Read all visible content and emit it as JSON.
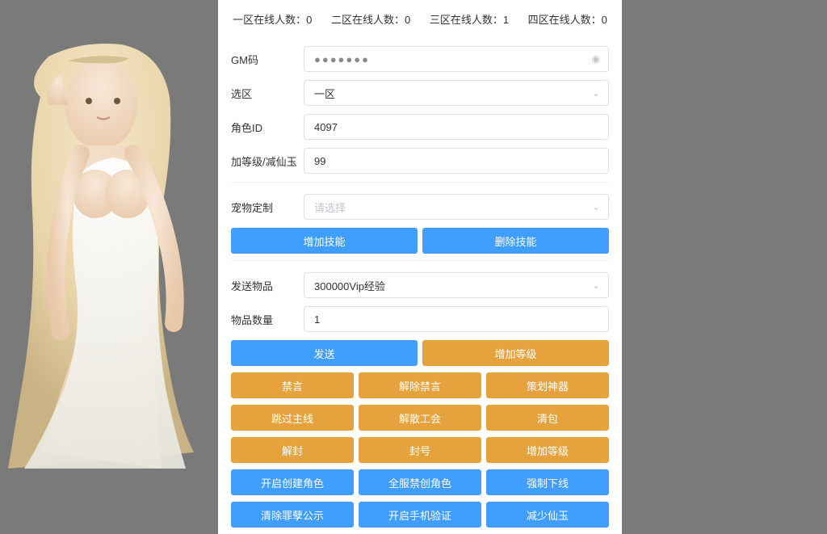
{
  "stats": {
    "zone1": "一区在线人数：0",
    "zone2": "二区在线人数：0",
    "zone3": "三区在线人数：1",
    "zone4": "四区在线人数：0"
  },
  "form": {
    "gm_code_label": "GM码",
    "gm_code_value": "●●●●●●●",
    "zone_label": "选区",
    "zone_value": "一区",
    "role_id_label": "角色ID",
    "role_id_value": "4097",
    "level_label": "加等级/减仙玉",
    "level_value": "99",
    "pet_label": "宠物定制",
    "pet_placeholder": "请选择",
    "send_item_label": "发送物品",
    "send_item_value": "300000Vip经验",
    "item_qty_label": "物品数量",
    "item_qty_value": "1"
  },
  "buttons": {
    "add_skill": "增加技能",
    "del_skill": "删除技能",
    "send": "发送",
    "add_level": "增加等级",
    "ban": "禁言",
    "unban": "解除禁言",
    "plan_weapon": "策划神器",
    "skip_main": "跳过主线",
    "disband_guild": "解散工会",
    "clear_bag": "清包",
    "unseal": "解封",
    "seal": "封号",
    "add_level2": "增加等级",
    "enable_create": "开启创建角色",
    "disable_create": "全服禁创角色",
    "force_offline": "强制下线",
    "clear_sin": "清除罪孽公示",
    "enable_phone": "开启手机验证",
    "reduce_jade": "减少仙玉"
  }
}
